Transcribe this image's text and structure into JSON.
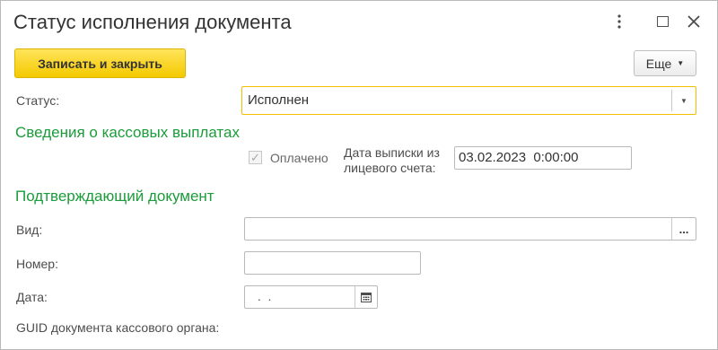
{
  "window": {
    "title": "Статус исполнения документа"
  },
  "toolbar": {
    "save_close_label": "Записать и закрыть",
    "more_label": "Еще"
  },
  "status": {
    "label": "Статус:",
    "value": "Исполнен"
  },
  "payments_section": {
    "title": "Сведения о кассовых выплатах",
    "paid_label": "Оплачено",
    "paid_checked": true,
    "date_label_line1": "Дата выписки из",
    "date_label_line2": "лицевого счета:",
    "date_value": "03.02.2023  0:00:00"
  },
  "confirm_section": {
    "title": "Подтверждающий документ",
    "type_label": "Вид:",
    "type_value": "",
    "type_pick": "...",
    "number_label": "Номер:",
    "number_value": "",
    "date_label": "Дата:",
    "date_value": " .  .",
    "guid_label": "GUID документа кассового органа:"
  },
  "colors": {
    "accent_yellow": "#f4c900",
    "section_green": "#1a9c3a",
    "focus_border": "#f2c000"
  },
  "icons": [
    "more-vertical-icon",
    "maximize-icon",
    "close-icon",
    "dropdown-arrow-icon",
    "checkmark-icon",
    "calendar-icon"
  ]
}
